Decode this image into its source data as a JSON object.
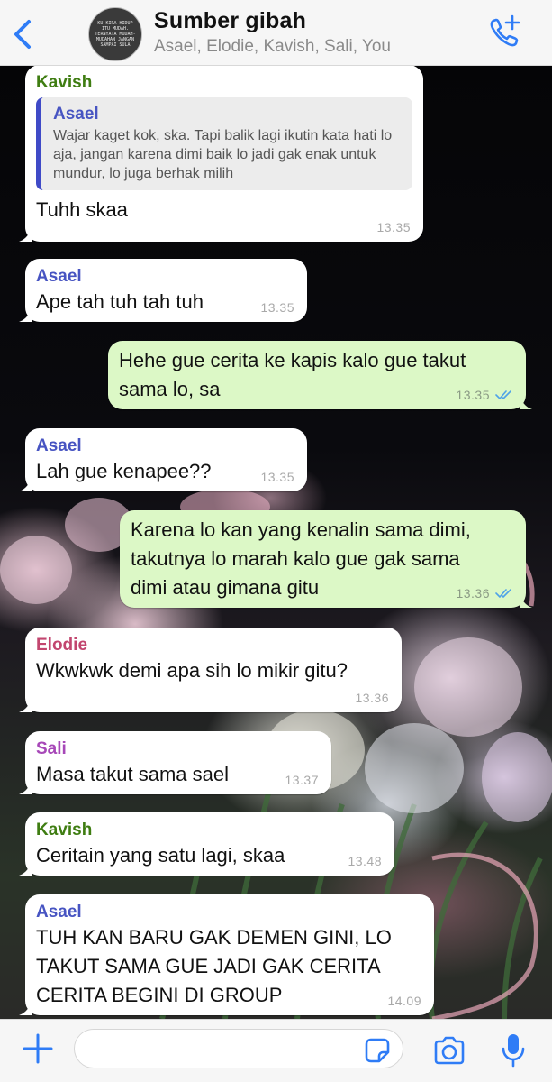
{
  "header": {
    "back_icon": "chevron-left-icon",
    "avatar_text": "KU KIRA HIDUP ITU MUDAH. TERNYATA MUDAH-MUDAHAN JANGAN SAMPAI SULA",
    "title": "Sumber gibah",
    "subtitle": "Asael, Elodie, Kavish, Sali, You",
    "call_icon": "add-call-icon",
    "accent_color": "#2f7cf6"
  },
  "messages": [
    {
      "sender": "Kavish",
      "sender_color": "#3f7d12",
      "quote": {
        "sender": "Asael",
        "text": "Wajar kaget kok, ska. Tapi balik lagi ikutin kata hati lo aja, jangan karena dimi baik lo jadi gak enak untuk mundur, lo juga berhak milih"
      },
      "text": "Tuhh skaa",
      "time": "13.35"
    },
    {
      "sender": "Asael",
      "sender_color": "#4754c2",
      "text": "Ape tah tuh tah tuh",
      "time": "13.35"
    },
    {
      "outgoing": true,
      "text": "Hehe gue cerita ke kapis kalo gue takut\nsama lo, sa",
      "time": "13.35",
      "status": "read"
    },
    {
      "sender": "Asael",
      "sender_color": "#4754c2",
      "text": "Lah gue kenapee??",
      "time": "13.35"
    },
    {
      "outgoing": true,
      "text": "Karena lo kan yang kenalin sama dimi,\ntakutnya lo marah kalo gue gak sama\ndimi atau gimana gitu",
      "time": "13.36",
      "status": "read"
    },
    {
      "sender": "Elodie",
      "sender_color": "#c2466f",
      "text": "Wkwkwk demi apa sih lo mikir gitu?",
      "time": "13.36"
    },
    {
      "sender": "Sali",
      "sender_color": "#a748b8",
      "text": "Masa takut sama sael",
      "time": "13.37"
    },
    {
      "sender": "Kavish",
      "sender_color": "#3f7d12",
      "text": "Ceritain yang satu lagi, skaa",
      "time": "13.48"
    },
    {
      "sender": "Asael",
      "sender_color": "#4754c2",
      "text": "TUH KAN BARU GAK DEMEN GINI, LO\nTAKUT SAMA GUE JADI GAK CERITA\nCERITA BEGINI DI GROUP",
      "time": "14.09"
    }
  ],
  "composer": {
    "plus_icon": "plus-icon",
    "input_value": "",
    "sticker_icon": "sticker-icon",
    "camera_icon": "camera-icon",
    "mic_icon": "microphone-icon"
  },
  "colors": {
    "incoming_bubble": "#ffffff",
    "outgoing_bubble": "#dcf8c6",
    "read_ticks": "#4fa3e8"
  }
}
